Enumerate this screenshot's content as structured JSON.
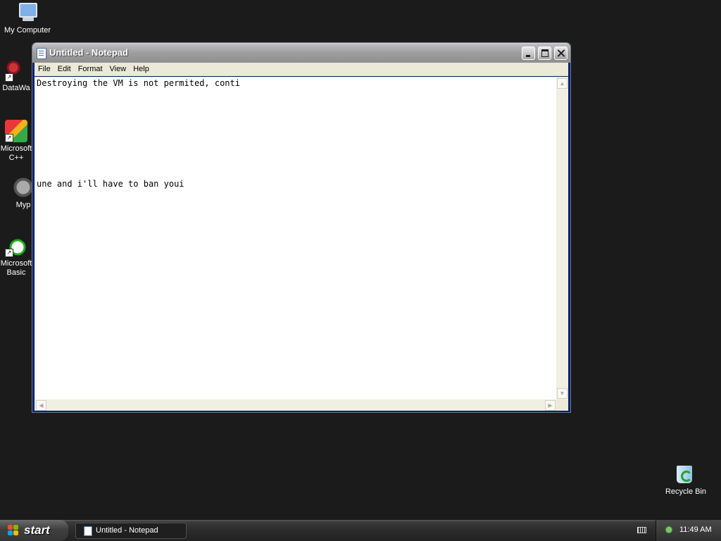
{
  "desktop": {
    "icons": [
      {
        "label": "My Computer"
      },
      {
        "label": "DataWa"
      },
      {
        "label": "Microsoft\nC++"
      },
      {
        "label": "Myp"
      },
      {
        "label": "Microsoft\nBasic"
      },
      {
        "label": "Recycle Bin"
      }
    ]
  },
  "window": {
    "title": "Untitled - Notepad",
    "menu": [
      "File",
      "Edit",
      "Format",
      "View",
      "Help"
    ],
    "content": {
      "line1": "Destroying the VM is not permited, conti",
      "line2": "une and i'll have to ban youi"
    }
  },
  "taskbar": {
    "start_label": "start",
    "tasks": [
      {
        "label": "Untitled - Notepad"
      }
    ],
    "clock": "11:49 AM"
  },
  "icons": {
    "my_computer": "computer-icon",
    "datawarehouse": "application-icon",
    "cpp": "visual-cpp-icon",
    "myp": "raccoon-icon",
    "basic": "visual-basic-icon",
    "recycle": "recycle-bin-icon",
    "notepad": "notepad-icon"
  }
}
